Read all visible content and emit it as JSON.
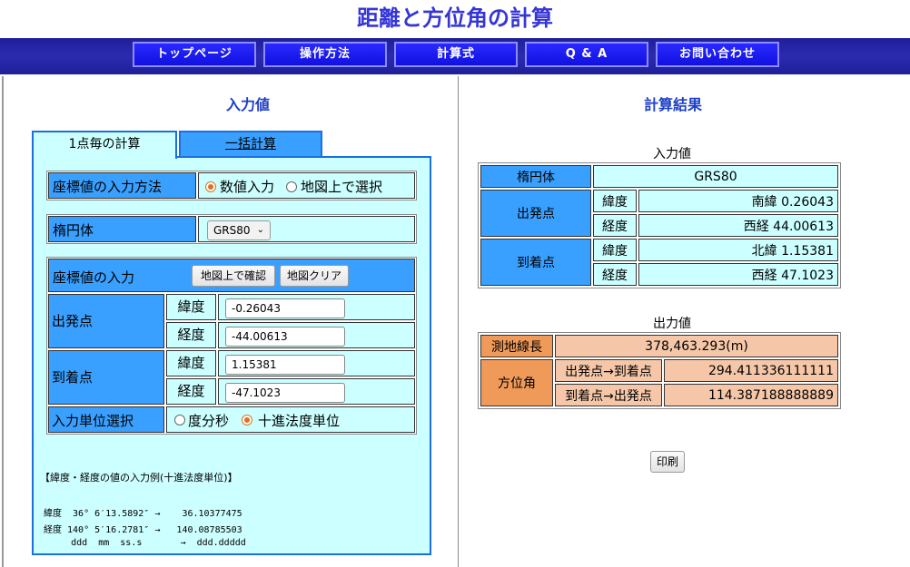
{
  "page": {
    "title": "距離と方位角の計算"
  },
  "nav": [
    "トップページ",
    "操作方法",
    "計算式",
    "Q & A",
    "お問い合わせ"
  ],
  "input_section": {
    "title": "入力値",
    "tabs": [
      "1点毎の計算",
      "一括計算"
    ],
    "method": {
      "label": "座標値の入力方法",
      "options": [
        "数値入力",
        "地図上で選択"
      ],
      "selected": "数値入力"
    },
    "ellipsoid": {
      "label": "楕円体",
      "value": "GRS80"
    },
    "coord": {
      "label": "座標値の入力",
      "btn_map_confirm": "地図上で確認",
      "btn_map_clear": "地図クリア",
      "start_label": "出発点",
      "end_label": "到着点",
      "lat_label": "緯度",
      "lon_label": "経度",
      "start_lat": "-0.26043",
      "start_lon": "-44.00613",
      "end_lat": "1.15381",
      "end_lon": "-47.1023"
    },
    "unit": {
      "label": "入力単位選択",
      "options": [
        "度分秒",
        "十進法度単位"
      ],
      "selected": "十進法度単位"
    },
    "example": {
      "heading": "【緯度・経度の値の入力例(十進法度単位)】",
      "line1": "緯度  36° 6′13.5892″ →    36.10377475",
      "line2": "経度 140° 5′16.2781″ →   140.08785503",
      "line3": "     ddd  mm  ss.s       →  ddd.ddddd"
    }
  },
  "result_section": {
    "title": "計算結果",
    "input_caption": "入力値",
    "ellipsoid_label": "楕円体",
    "ellipsoid_value": "GRS80",
    "start_label": "出発点",
    "end_label": "到着点",
    "lat_label": "緯度",
    "lon_label": "経度",
    "start_lat": "南緯 0.26043",
    "start_lon": "西経 44.00613",
    "end_lat": "北緯 1.15381",
    "end_lon": "西経 47.1023",
    "output_caption": "出力値",
    "distance_label": "測地線長",
    "distance_value": "378,463.293(m)",
    "azimuth_label": "方位角",
    "az_forward_label": "出発点→到着点",
    "az_forward_value": "294.411336111111",
    "az_back_label": "到着点→出発点",
    "az_back_value": "114.387188888889",
    "print_label": "印刷"
  },
  "colors": {
    "accent_blue": "#3aa0ff",
    "nav_bg": "#1f1f9a",
    "panel_cyan": "#ccffff",
    "output_orange": "#f09a5a"
  }
}
